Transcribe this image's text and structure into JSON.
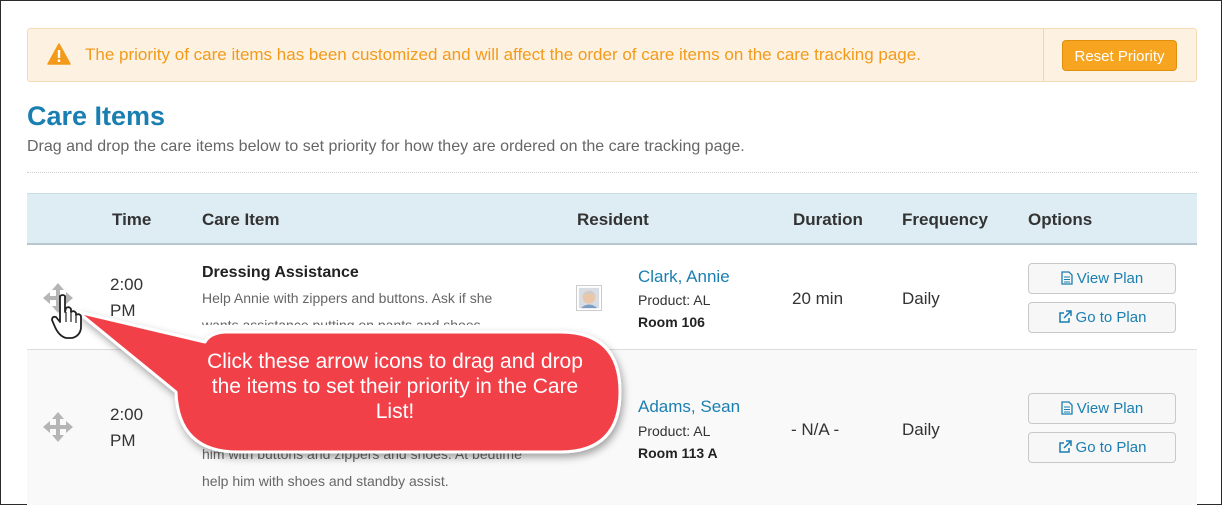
{
  "alert": {
    "message": "The priority of care items has been customized and will affect the order of care items on the care tracking page.",
    "reset_label": "Reset Priority"
  },
  "page": {
    "title": "Care Items",
    "subtitle": "Drag and drop the care items below to set priority for how they are ordered on the care tracking page."
  },
  "table": {
    "headers": {
      "time": "Time",
      "care_item": "Care Item",
      "resident": "Resident",
      "duration": "Duration",
      "frequency": "Frequency",
      "options": "Options"
    },
    "rows": [
      {
        "time_line1": "2:00",
        "time_line2": "PM",
        "name": "Dressing Assistance",
        "description": "Help Annie with zippers and buttons. Ask if she wants assistance putting on pants and shoes.",
        "resident_name": "Clark, Annie",
        "product": "Product: AL",
        "room": "Room 106",
        "duration": "20 min",
        "frequency": "Daily",
        "view_label": "View Plan",
        "go_label": "Go to Plan"
      },
      {
        "time_line1": "2:00",
        "time_line2": "PM",
        "description": "him with buttons and zippers and shoes. At bedtime help him with shoes and standby assist.",
        "resident_name": "Adams, Sean",
        "product": "Product: AL",
        "room": "Room 113 A",
        "duration": "- N/A -",
        "frequency": "Daily",
        "view_label": "View Plan",
        "go_label": "Go to Plan"
      }
    ]
  },
  "callout": {
    "text": "Click these arrow icons to drag and drop the items to set their priority in the Care List!",
    "color": "#f2414a"
  },
  "colors": {
    "accent": "#1a7fb0",
    "warning": "#f39a1b",
    "reset_button": "#f7a521",
    "header_bg": "#deedf4"
  },
  "icons": [
    "warning-icon",
    "move-arrows-icon",
    "hand-pointer-icon",
    "file-text-icon",
    "external-link-icon",
    "avatar-icon"
  ]
}
